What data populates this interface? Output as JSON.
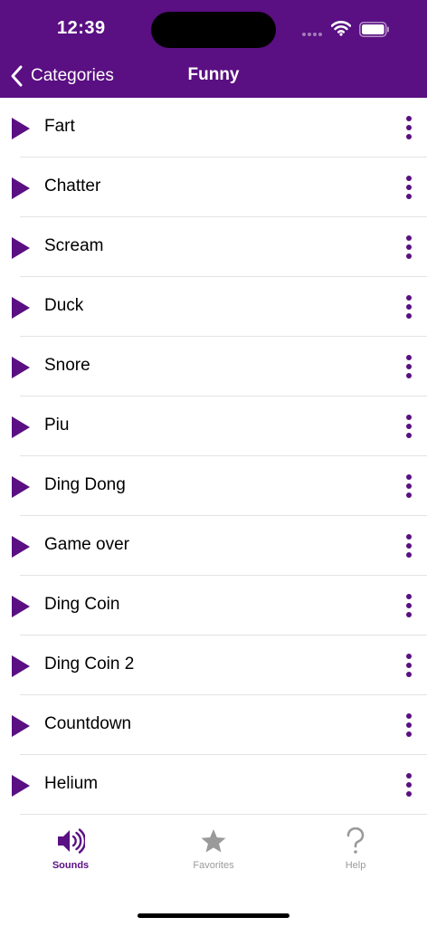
{
  "status_bar": {
    "time": "12:39"
  },
  "nav": {
    "back_label": "Categories",
    "title": "Funny"
  },
  "sounds": [
    {
      "label": "Fart"
    },
    {
      "label": "Chatter"
    },
    {
      "label": "Scream"
    },
    {
      "label": "Duck"
    },
    {
      "label": "Snore"
    },
    {
      "label": "Piu"
    },
    {
      "label": "Ding Dong"
    },
    {
      "label": "Game over"
    },
    {
      "label": "Ding Coin"
    },
    {
      "label": "Ding Coin 2"
    },
    {
      "label": "Countdown"
    },
    {
      "label": "Helium"
    }
  ],
  "tabs": [
    {
      "label": "Sounds",
      "icon": "speaker-icon",
      "active": true
    },
    {
      "label": "Favorites",
      "icon": "star-icon",
      "active": false
    },
    {
      "label": "Help",
      "icon": "question-icon",
      "active": false
    }
  ],
  "colors": {
    "accent": "#5a0f82",
    "inactive": "#9a9a9a",
    "separator": "#e3e3e8"
  }
}
